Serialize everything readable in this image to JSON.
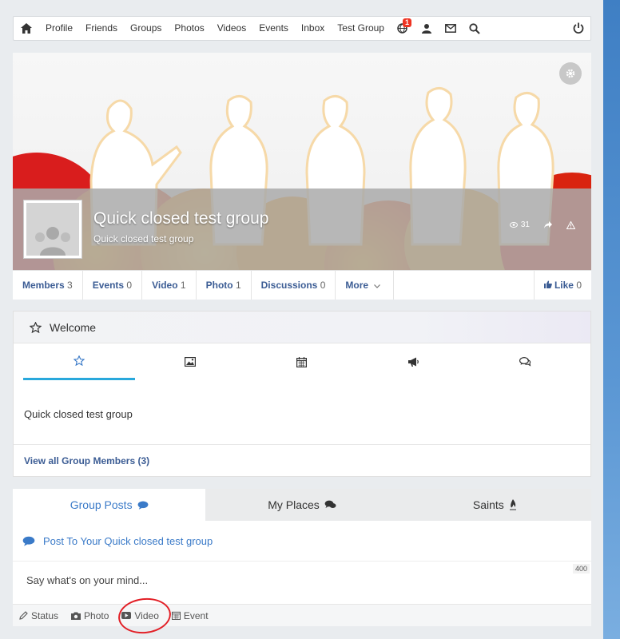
{
  "nav": {
    "items": [
      "Profile",
      "Friends",
      "Groups",
      "Photos",
      "Videos",
      "Events",
      "Inbox",
      "Test Group"
    ],
    "notif_badge": "1",
    "icons": [
      "home-icon",
      "globe-icon",
      "friend-requests-icon",
      "envelope-icon",
      "search-icon",
      "power-icon"
    ]
  },
  "group": {
    "title": "Quick closed test group",
    "subtitle": "Quick closed test group",
    "views": "31"
  },
  "tabs": [
    {
      "label": "Members",
      "count": "3"
    },
    {
      "label": "Events",
      "count": "0"
    },
    {
      "label": "Video",
      "count": "1"
    },
    {
      "label": "Photo",
      "count": "1"
    },
    {
      "label": "Discussions",
      "count": "0"
    },
    {
      "label": "More",
      "count": ""
    }
  ],
  "like": {
    "label": "Like",
    "count": "0"
  },
  "welcome": {
    "title": "Welcome",
    "text": "Quick closed test group",
    "view_all": "View all Group Members (3)"
  },
  "posts": {
    "tabs": [
      "Group Posts",
      "My Places",
      "Saints"
    ],
    "header": "Post To Your Quick closed test group",
    "counter": "400",
    "placeholder": "Say what's on your mind...",
    "actions": [
      "Status",
      "Photo",
      "Video",
      "Event"
    ]
  },
  "colors": {
    "accent": "#3a7ac8",
    "link": "#3b5c94",
    "tab_underline": "#29a8dc",
    "annotation": "#e21f26"
  }
}
